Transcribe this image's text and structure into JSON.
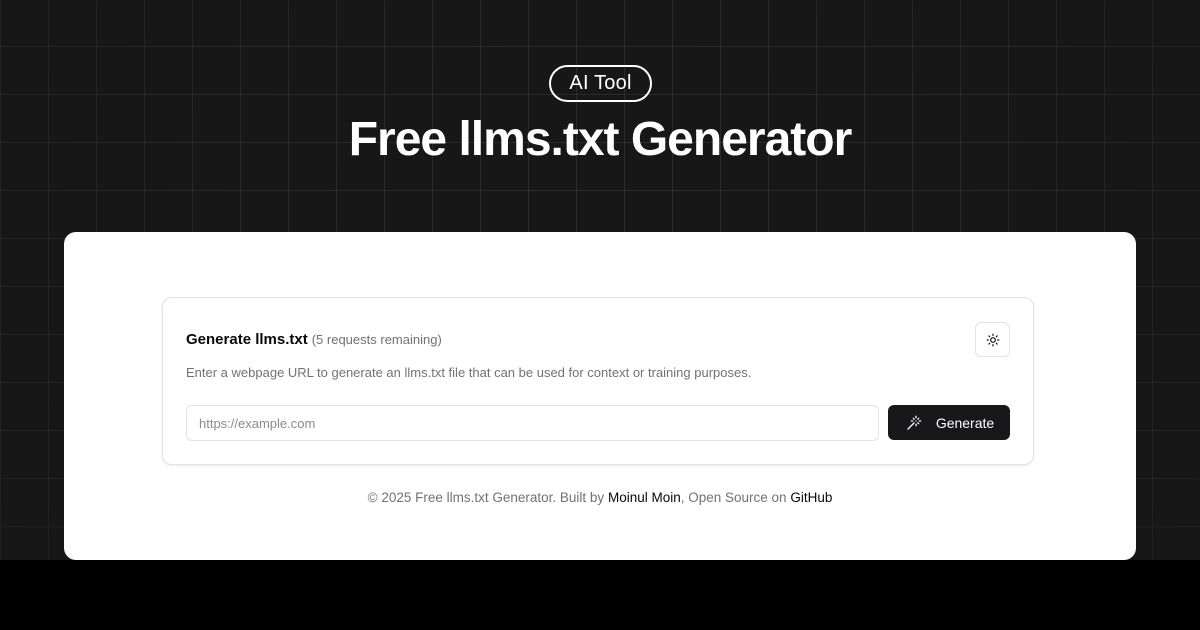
{
  "header": {
    "badge": "AI Tool",
    "title": "Free llms.txt Generator"
  },
  "card": {
    "title": "Generate llms.txt",
    "remaining": "(5 requests remaining)",
    "description": "Enter a webpage URL to generate an llms.txt file that can be used for context or training purposes.",
    "input_placeholder": "https://example.com",
    "input_value": "",
    "generate_label": "Generate",
    "theme_toggle_icon": "sun-icon",
    "generate_icon": "magic-wand-icon"
  },
  "footer": {
    "prefix": "© 2025 Free llms.txt Generator. Built by ",
    "author_link": "Moinul Moin",
    "middle": ", Open Source on ",
    "github_link": "GitHub"
  },
  "colors": {
    "hero_background": "#171717",
    "panel_background": "#ffffff",
    "button_background": "#18181b",
    "muted_text": "#71717a"
  }
}
